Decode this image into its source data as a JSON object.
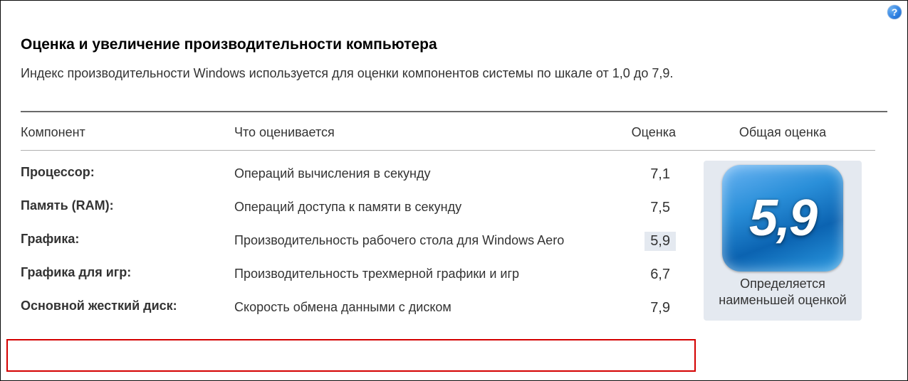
{
  "help_tooltip": "?",
  "title": "Оценка и увеличение производительности компьютера",
  "subtitle": "Индекс производительности Windows используется для оценки компонентов системы по шкале от 1,0 до 7,9.",
  "headers": {
    "component": "Компонент",
    "what": "Что оценивается",
    "score": "Оценка",
    "overall": "Общая оценка"
  },
  "rows": [
    {
      "name": "Процессор:",
      "desc": "Операций вычисления в секунду",
      "score": "7,1",
      "lowest": false
    },
    {
      "name": "Память (RAM):",
      "desc": "Операций доступа к памяти в секунду",
      "score": "7,5",
      "lowest": false
    },
    {
      "name": "Графика:",
      "desc": "Производительность рабочего стола для Windows Aero",
      "score": "5,9",
      "lowest": true
    },
    {
      "name": "Графика для игр:",
      "desc": "Производительность трехмерной графики и игр",
      "score": "6,7",
      "lowest": false
    },
    {
      "name": "Основной жесткий диск:",
      "desc": "Скорость обмена данными с диском",
      "score": "7,9",
      "lowest": false
    }
  ],
  "overall": {
    "score": "5,9",
    "caption": "Определяется наименьшей оценкой"
  }
}
